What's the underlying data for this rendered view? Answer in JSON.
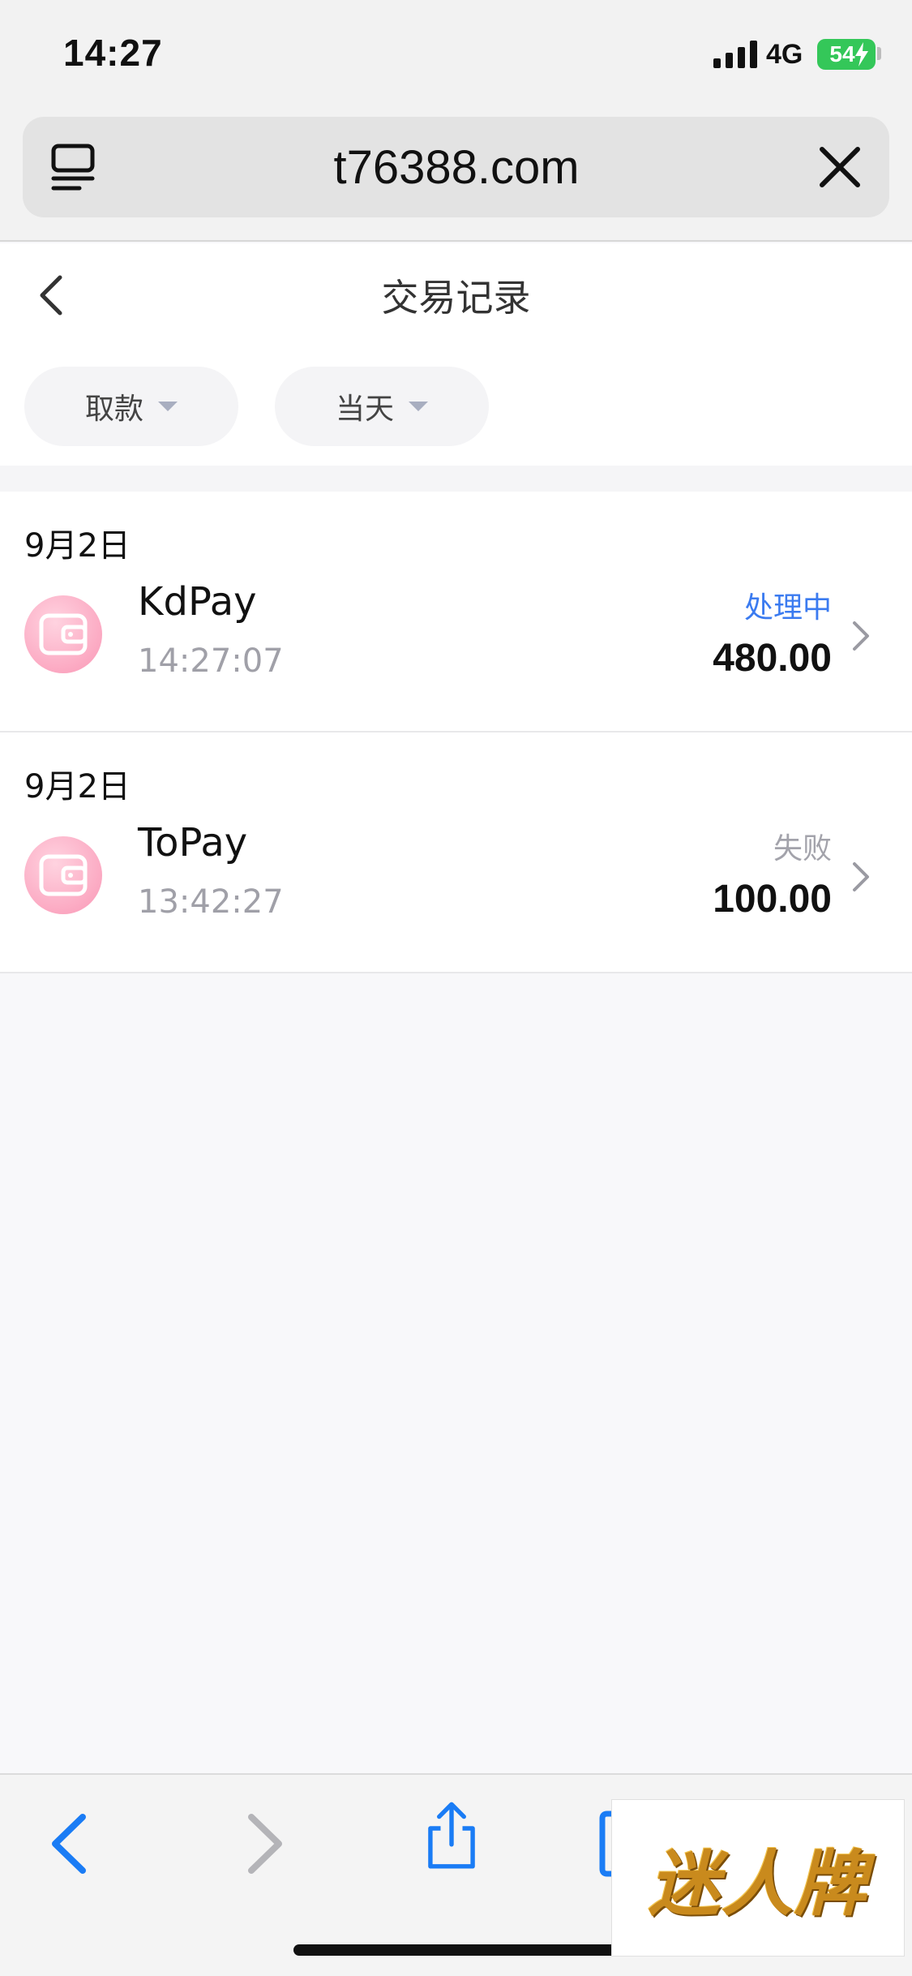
{
  "status_bar": {
    "time": "14:27",
    "network": "4G",
    "battery": "54",
    "battery_color": "#34c759"
  },
  "url_bar": {
    "url": "t76388.com"
  },
  "page": {
    "title": "交易记录"
  },
  "filters": [
    {
      "label": "取款"
    },
    {
      "label": "当天"
    }
  ],
  "transactions": [
    {
      "date": "9月2日",
      "name": "KdPay",
      "time": "14:27:07",
      "status": "处理中",
      "amount": "480.00",
      "status_color": "#3b7bf0"
    },
    {
      "date": "9月2日",
      "name": "ToPay",
      "time": "13:42:27",
      "status": "失败",
      "amount": "100.00",
      "status_color": "#a3a3ab"
    }
  ],
  "toolbar": {
    "icons": [
      "back-icon",
      "forward-icon",
      "share-icon",
      "bookmarks-icon"
    ],
    "accent": "#1a7cf5"
  },
  "watermark": {
    "text": "迷人牌"
  }
}
